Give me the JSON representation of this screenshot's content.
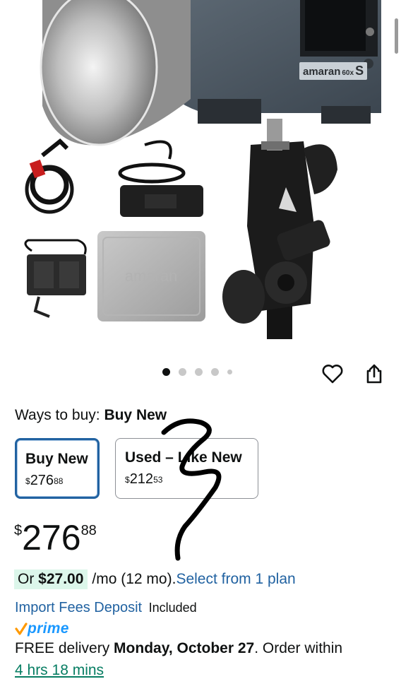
{
  "product_image": {
    "case_text": "amaran",
    "light_brand": "amaran",
    "light_model": "60x",
    "light_suffix": "S",
    "dot_count": 5,
    "active_dot": 0
  },
  "icons": {
    "favorite": "heart-outline-icon",
    "share": "share-icon"
  },
  "ways_to_buy": {
    "label": "Ways to buy: ",
    "selected": "Buy New",
    "options": [
      {
        "title": "Buy New",
        "currency": "$",
        "whole": "276",
        "fraction": "88"
      },
      {
        "title": "Used – Like New",
        "currency": "$",
        "whole": "212",
        "fraction": "53"
      }
    ]
  },
  "price": {
    "currency": "$",
    "whole": "276",
    "fraction": "88"
  },
  "installment": {
    "or": "Or ",
    "amount": "$27.00",
    "terms": "/mo (12 mo). ",
    "link": "Select from 1 plan"
  },
  "import_fees": {
    "link": "Import Fees Deposit",
    "value": "Included"
  },
  "prime": {
    "check": "✓",
    "label": "prime"
  },
  "delivery": {
    "prefix": "FREE delivery ",
    "date": "Monday, October 27",
    "suffix": ". Order within",
    "countdown": "4 hrs 18 mins"
  },
  "colors": {
    "link": "#2162a1",
    "prime": "#1a98ff",
    "selected_border": "#2162a1",
    "installment_bg": "#dcf6ea",
    "countdown": "#067d62"
  }
}
